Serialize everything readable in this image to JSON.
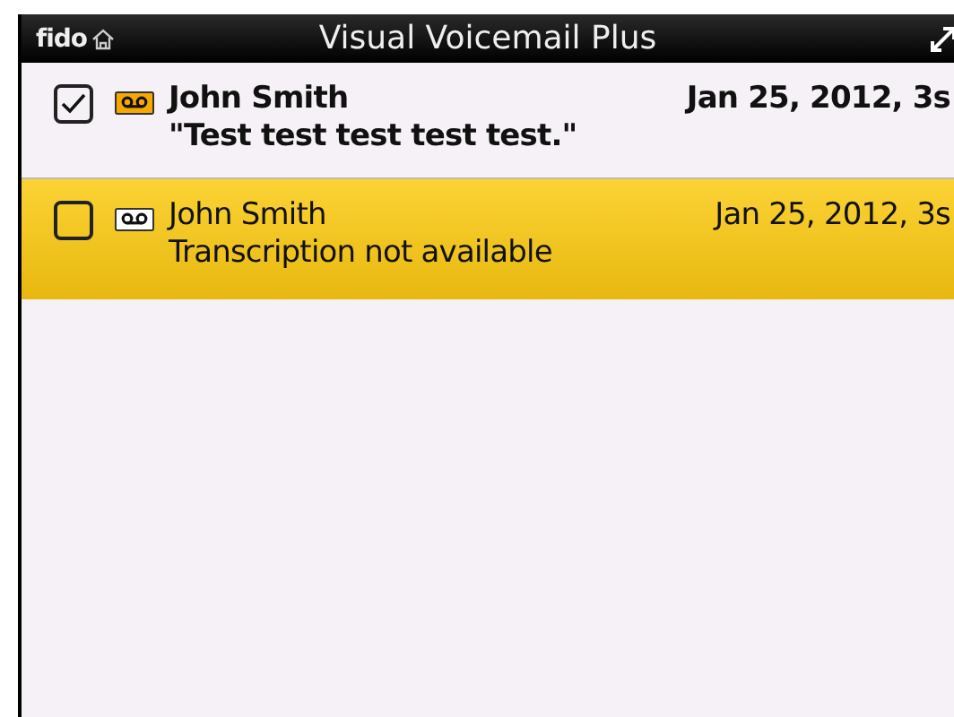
{
  "header": {
    "carrier": "fido",
    "title": "Visual Voicemail Plus"
  },
  "messages": [
    {
      "caller": "John Smith",
      "preview": "\"Test test test test test.\"",
      "date": "Jan 25, 2012, 3s",
      "checked": true,
      "unread": true,
      "selected": false
    },
    {
      "caller": "John Smith",
      "preview": "Transcription not available",
      "date": "Jan 25, 2012, 3s",
      "checked": false,
      "unread": false,
      "selected": true
    }
  ]
}
